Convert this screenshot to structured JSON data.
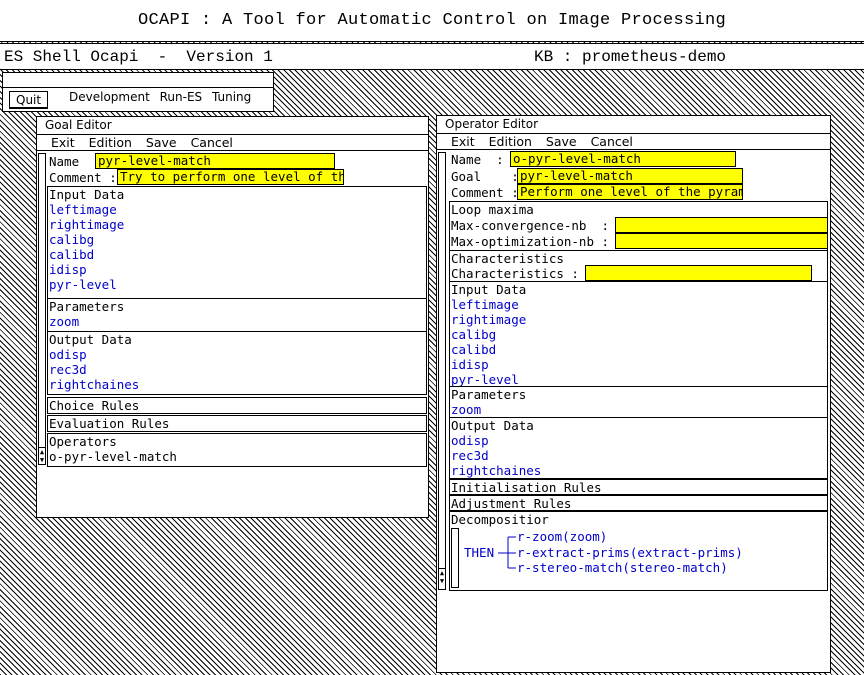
{
  "app": {
    "title": "OCAPI : A Tool for Automatic Control on Image Processing",
    "shell_label": "ES Shell Ocapi  -  Version 1",
    "kb_label": "KB : prometheus-demo"
  },
  "toolbar": {
    "quit_label": "Quit",
    "menu_items": [
      "Development",
      "Run-ES",
      "Tuning"
    ]
  },
  "goal_editor": {
    "title": "Goal Editor",
    "menu": [
      "Exit",
      "Edition",
      "Save",
      "Cancel"
    ],
    "name_label": "Name  :",
    "name_value": "pyr-level-match",
    "comment_label": "Comment :",
    "comment_value": "Try to perform one level of th",
    "input_data": {
      "header": "Input Data",
      "items": [
        "leftimage",
        "rightimage",
        "calibg",
        "calibd",
        "idisp",
        "pyr-level"
      ]
    },
    "parameters": {
      "header": "Parameters",
      "items": [
        "zoom"
      ]
    },
    "output_data": {
      "header": "Output Data",
      "items": [
        "odisp",
        "rec3d",
        "rightchaines"
      ]
    },
    "choice_rules": "Choice Rules",
    "evaluation_rules": "Evaluation Rules",
    "operators": {
      "header": "Operators",
      "items": [
        "o-pyr-level-match"
      ]
    }
  },
  "operator_editor": {
    "title": "Operator Editor",
    "menu": [
      "Exit",
      "Edition",
      "Save",
      "Cancel"
    ],
    "name_label": "Name  :",
    "name_value": "o-pyr-level-match",
    "goal_label": "Goal    :",
    "goal_value": "pyr-level-match",
    "comment_label": "Comment :",
    "comment_value": "Perform one level of the pyram",
    "loop_maxima": {
      "header": "Loop maxima",
      "max_convergence_label": "Max-convergence-nb  :",
      "max_optimization_label": "Max-optimization-nb :",
      "max_convergence_value": "",
      "max_optimization_value": ""
    },
    "characteristics": {
      "header": "Characteristics",
      "label": "Characteristics :",
      "value": ""
    },
    "input_data": {
      "header": "Input Data",
      "items": [
        "leftimage",
        "rightimage",
        "calibg",
        "calibd",
        "idisp",
        "pyr-level"
      ]
    },
    "parameters": {
      "header": "Parameters",
      "items": [
        "zoom"
      ]
    },
    "output_data": {
      "header": "Output Data",
      "items": [
        "odisp",
        "rec3d",
        "rightchaines"
      ]
    },
    "initialisation_rules": "Initialisation Rules",
    "adjustment_rules": "Adjustment Rules",
    "decomposition": {
      "header": "Decompositior",
      "then_label": "THEN",
      "branches": [
        "r-zoom(zoom)",
        "r-extract-prims(extract-prims)",
        "r-stereo-match(stereo-match)"
      ]
    }
  },
  "colors": {
    "field": "#ffff00",
    "list_text": "#0000cc",
    "pattern": "#000000"
  }
}
